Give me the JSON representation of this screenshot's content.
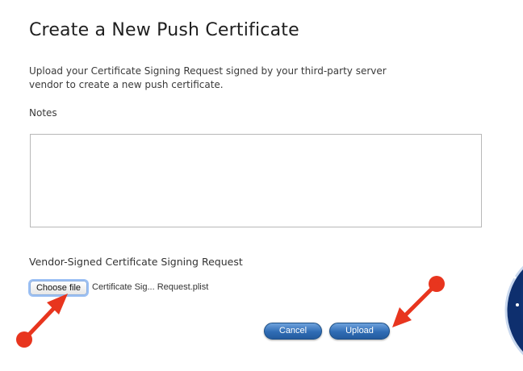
{
  "page": {
    "title": "Create a New Push Certificate",
    "description": "Upload your Certificate Signing Request signed by your third-party server vendor to create a new push certificate."
  },
  "form": {
    "notes_label": "Notes",
    "notes_value": "",
    "csr_label": "Vendor-Signed Certificate Signing Request",
    "choose_file_label": "Choose file",
    "file_name": "Certificate Sig... Request.plist"
  },
  "actions": {
    "cancel_label": "Cancel",
    "upload_label": "Upload"
  },
  "colors": {
    "annotation_red": "#e8351e",
    "button_blue": "#2f6cb4",
    "background_globe": "#1c4fa6"
  },
  "annotations": [
    {
      "type": "arrow",
      "points_to": "choose-file-button"
    },
    {
      "type": "arrow",
      "points_to": "upload-button"
    }
  ]
}
